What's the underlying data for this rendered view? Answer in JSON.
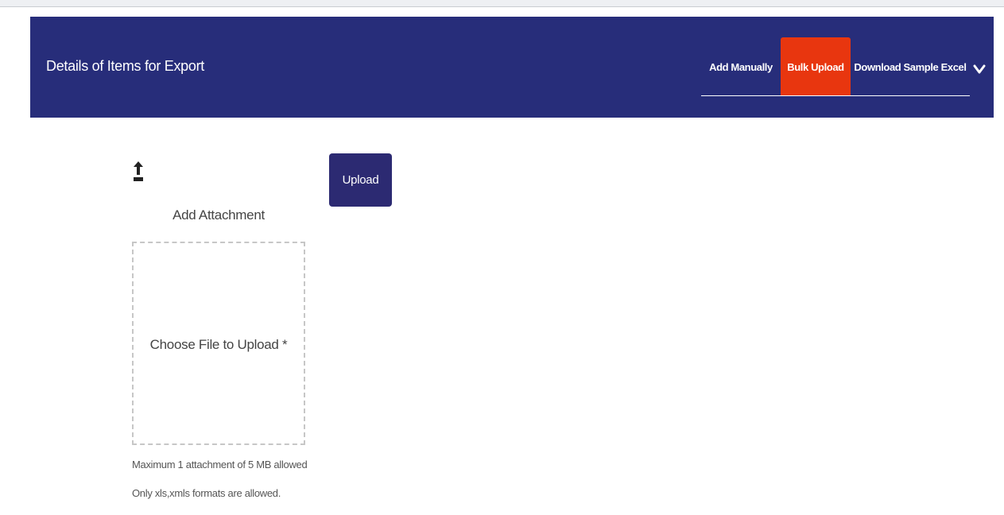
{
  "header": {
    "title": "Details of Items for Export",
    "tabs": [
      {
        "label": "Add Manually",
        "active": false
      },
      {
        "label": "Bulk Upload",
        "active": true
      },
      {
        "label": "Download Sample Excel",
        "active": false
      }
    ],
    "collapse_icon": "chevron-down-icon"
  },
  "attachment": {
    "icon": "upload-arrow-icon",
    "title": "Add Attachment",
    "dropzone_label": "Choose File to Upload *",
    "note_size": "Maximum 1 attachment of 5 MB allowed",
    "note_formats": "Only xls,xmls formats are allowed."
  },
  "upload_button": {
    "label": "Upload"
  },
  "colors": {
    "header_bg": "#272d7a",
    "active_tab": "#e8360f",
    "upload_button_bg": "#2c2a72",
    "text": "#444444"
  }
}
